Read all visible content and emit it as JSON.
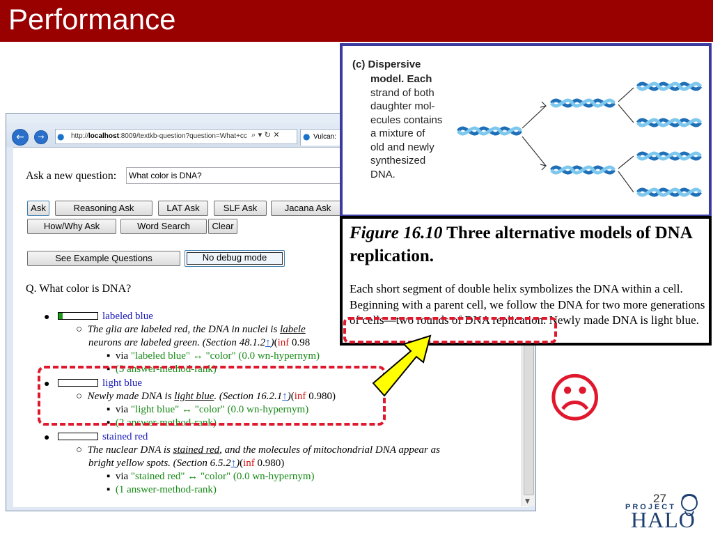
{
  "slide": {
    "title": "Performance",
    "page_number": "27"
  },
  "browser": {
    "url_prefix": "http://",
    "url_host": "localhost",
    "url_rest": ":8009/textkb-question?question=What+cc",
    "url_tools": "⌕ ▾ ↻ ✕",
    "tab_title": "Vulcan:"
  },
  "form": {
    "ask_label": "Ask a new question:",
    "question_value": "What color is DNA?",
    "buttons": {
      "ask": "Ask",
      "reasoning_ask": "Reasoning Ask",
      "lat_ask": "LAT Ask",
      "slf_ask": "SLF Ask",
      "jacana_ask": "Jacana Ask",
      "how_why_ask": "How/Why Ask",
      "word_search": "Word Search",
      "clear": "Clear",
      "see_example_questions": "See Example Questions",
      "no_debug_mode": "No debug mode"
    }
  },
  "results": {
    "question_echo": "Q. What color is DNA?",
    "answers": [
      {
        "answer": "labeled blue",
        "confidence": 0.1,
        "evidence_a": "The glia are labeled red, the DNA in nuclei is ",
        "evidence_u": "labele",
        "evidence_b": "neurons are labeled green. (Section 48.1.2",
        "arrow": "↑",
        "inf": "inf",
        "score": "0.98",
        "via_label": "via ",
        "via_text": "\"labeled blue\" ↔ \"color\" (0.0 wn-hypernym)",
        "rank": "(3 answer-method-rank)"
      },
      {
        "answer": "light blue",
        "confidence": 0.0,
        "evidence_a": "Newly made DNA is ",
        "evidence_u": "light blue",
        "evidence_b": ". (Section 16.2.1",
        "arrow": "↑",
        "inf": "inf",
        "score": "0.980)",
        "via_label": "via ",
        "via_text": "\"light blue\" ↔ \"color\" (0.0 wn-hypernym)",
        "rank": "(2 answer-method-rank)"
      },
      {
        "answer": "stained red",
        "confidence": 0.0,
        "evidence_a": "The nuclear DNA is ",
        "evidence_u": "stained red",
        "evidence_b": ", and the molecules of mitochondrial DNA appear as",
        "evidence_c": "bright yellow spots. (Section 6.5.2",
        "arrow": "↑",
        "inf": "inf",
        "score": "0.980)",
        "via_label": "via ",
        "via_text": "\"stained red\" ↔ \"color\" (0.0 wn-hypernym)",
        "rank": "(1 answer-method-rank)"
      }
    ]
  },
  "figure": {
    "heading": "(c) Dispersive",
    "desc_lines": [
      "model. Each",
      "strand of both",
      "daughter mol-",
      "ecules contains",
      "a mixture of",
      "old and newly",
      "synthesized",
      "DNA."
    ],
    "caption_label": "Figure 16.10",
    "caption_title": " Three alternative models of DNA replication.",
    "caption_body": "Each short segment of double helix symbolizes the DNA within a cell. Beginning with a parent cell, we follow the DNA for two more generations of cells—two rounds of DNA replication. Newly made DNA is light blue."
  },
  "colors": {
    "title_bar": "#990000",
    "highlight": "#e0182e",
    "arrow_fill": "#ffff00",
    "helix": "#2a9ad8"
  },
  "icons": {
    "back": "back-arrow-icon",
    "forward": "forward-arrow-icon",
    "sad_face": "☹"
  }
}
